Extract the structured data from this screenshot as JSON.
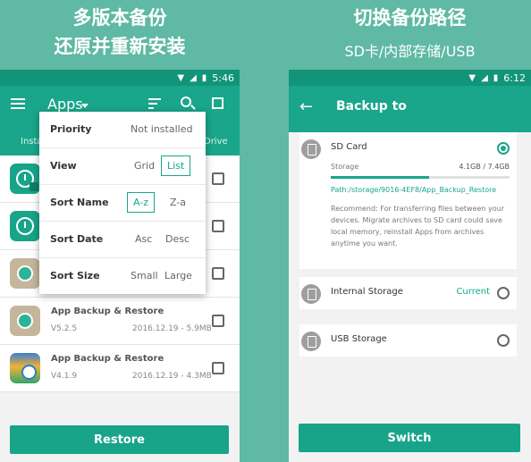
{
  "colors": {
    "accent": "#19a68a",
    "status_bar": "#129479",
    "background": "#5fb9a4"
  },
  "left": {
    "headline1": "多版本备份",
    "headline2": "还原并重新安装",
    "status_time": "5:46",
    "app_title": "Apps",
    "tab_left": "Insta",
    "tab_right": "Drive",
    "menu": {
      "priority": {
        "label": "Priority",
        "value": "Not installed"
      },
      "view": {
        "label": "View",
        "options": [
          "Grid",
          "List"
        ],
        "selected": "List"
      },
      "sort_name": {
        "label": "Sort Name",
        "options": [
          "A-z",
          "Z-a"
        ],
        "selected": "A-z"
      },
      "sort_date": {
        "label": "Sort Date",
        "options": [
          "Asc",
          "Desc"
        ]
      },
      "sort_size": {
        "label": "Sort Size",
        "options": [
          "Small",
          "Large"
        ]
      }
    },
    "apps": [
      {
        "name": "",
        "version": "",
        "meta": ""
      },
      {
        "name": "",
        "version": "",
        "meta": ""
      },
      {
        "name": "",
        "version": "",
        "meta": ""
      },
      {
        "name": "App Backup & Restore",
        "version": "V5.2.5",
        "meta": "2016.12.19 - 5.9MB"
      },
      {
        "name": "App Backup & Restore",
        "version": "V4.1.9",
        "meta": "2016.12.19 - 4.3MB"
      }
    ],
    "button": "Restore"
  },
  "right": {
    "headline1": "切换备份路径",
    "headline2": "SD卡/内部存储/USB",
    "status_time": "6:12",
    "title": "Backup to",
    "sd": {
      "label": "SD Card",
      "storage_label": "Storage",
      "storage_value": "4.1GB / 7.4GB",
      "used_fraction": 0.55,
      "path": "Path:/storage/9016-4EF8/App_Backup_Restore",
      "recommend": "Recommend: For transferring files between your devices. Migrate archives to SD card could save local memory, reinstall Apps from archives anytime you want."
    },
    "internal": {
      "label": "Internal Storage",
      "current": "Current"
    },
    "usb": {
      "label": "USB Storage"
    },
    "button": "Switch"
  }
}
